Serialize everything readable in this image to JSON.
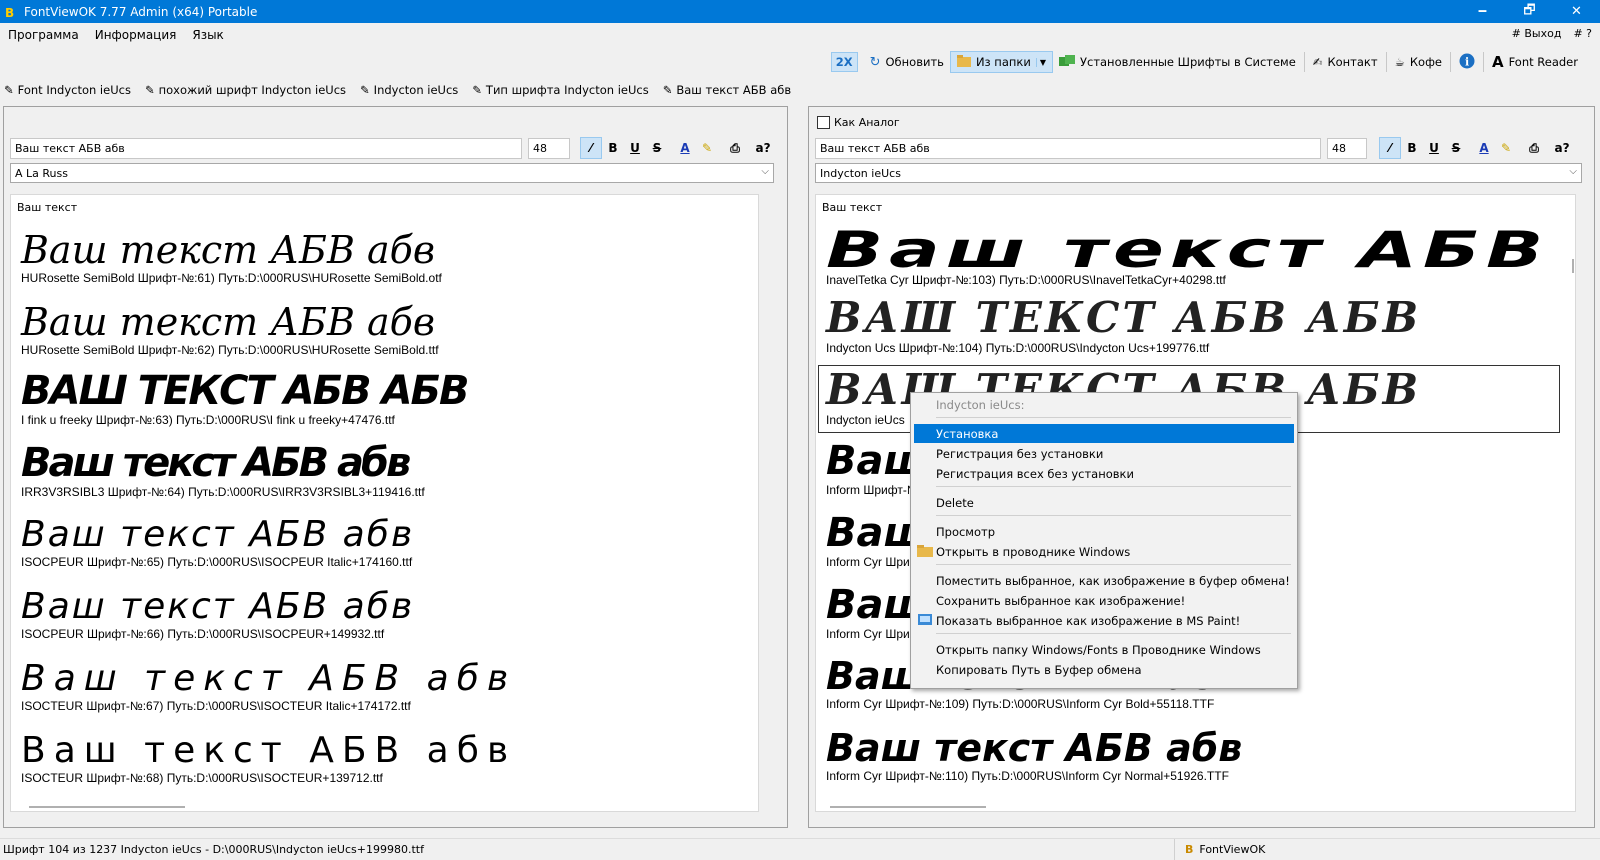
{
  "window": {
    "title": "FontViewOK 7.77 Admin (x64) Portable",
    "minimize": "🗕",
    "maximize": "🗗",
    "close": "✕"
  },
  "menubar": {
    "items": [
      "Программа",
      "Информация",
      "Язык"
    ],
    "exit": "# Выход",
    "help": "# ?"
  },
  "toolbar": {
    "zoom": "2X",
    "refresh": "Обновить",
    "from_folder": "Из папки",
    "installed": "Установленные Шрифты в Системе",
    "contact": "Контакт",
    "coffee": "Кофе",
    "font_reader": "Font Reader"
  },
  "tabs": [
    "Font Indycton ieUcs",
    "похожий шрифт  Indycton ieUcs",
    "Indycton ieUcs",
    "Тип шрифта  Indycton ieUcs",
    "Ваш текст АБВ абв"
  ],
  "left": {
    "text": "Ваш текст АБВ абв",
    "size": "48",
    "font": "A La Russ",
    "caption": "Ваш текст",
    "entries": [
      {
        "sample": "Ваш текст АБВ абв",
        "info": "HURosette SemiBold Шрифт-№:61) Путь:D:\\000RUS\\HURosette SemiBold.otf"
      },
      {
        "sample": "Ваш текст АБВ абв",
        "info": "HURosette SemiBold Шрифт-№:62) Путь:D:\\000RUS\\HURosette SemiBold.ttf"
      },
      {
        "sample": "ВАШ ТЕКСТ АБВ АБВ",
        "info": "I fink u freeky Шрифт-№:63) Путь:D:\\000RUS\\I fink u freeky+47476.ttf"
      },
      {
        "sample": "Ваш текст АБВ абв",
        "info": "IRR3V3RSIBL3 Шрифт-№:64) Путь:D:\\000RUS\\IRR3V3RSIBL3+119416.ttf"
      },
      {
        "sample": "Ваш текст АБВ абв",
        "info": "ISOCPEUR Шрифт-№:65) Путь:D:\\000RUS\\ISOCPEUR Italic+174160.ttf"
      },
      {
        "sample": "Ваш текст АБВ абв",
        "info": "ISOCPEUR Шрифт-№:66) Путь:D:\\000RUS\\ISOCPEUR+149932.ttf"
      },
      {
        "sample": "Ваш  текст  АБВ  абв",
        "info": "ISOCTEUR Шрифт-№:67) Путь:D:\\000RUS\\ISOCTEUR Italic+174172.ttf"
      },
      {
        "sample": "Ваш  текст  АБВ  абв",
        "info": "ISOCTEUR Шрифт-№:68) Путь:D:\\000RUS\\ISOCTEUR+139712.ttf"
      }
    ]
  },
  "right": {
    "analog_label": "Как Аналог",
    "text": "Ваш текст АБВ абв",
    "size": "48",
    "font": "Indycton ieUcs",
    "caption": "Ваш текст",
    "entries": [
      {
        "sample": "Ваш текст АБВ а",
        "info": "InavelTetka Cyr Шрифт-№:103) Путь:D:\\000RUS\\InavelTetkaCyr+40298.ttf"
      },
      {
        "sample": "ВАШ ТЕКСТ АБВ АБВ",
        "info": "Indycton Ucs Шрифт-№:104) Путь:D:\\000RUS\\Indycton Ucs+199776.ttf"
      },
      {
        "sample": "ВАШ ТЕКСТ АБВ АБВ",
        "info": "Indycton ieUcs"
      },
      {
        "sample": "Ваш",
        "info": "Inform Шрифт-№"
      },
      {
        "sample": "Ваш",
        "info": "Inform Cyr Шри"
      },
      {
        "sample": "Ваш",
        "info": "Inform Cyr Шри"
      },
      {
        "sample": "Ваш текст АБВ абв",
        "info": "Inform Cyr Шрифт-№:109) Путь:D:\\000RUS\\Inform Cyr Bold+55118.TTF"
      },
      {
        "sample": "Ваш текст АБВ абв",
        "info": "Inform Cyr Шрифт-№:110) Путь:D:\\000RUS\\Inform Cyr Normal+51926.TTF"
      }
    ]
  },
  "context_menu": {
    "header": "Indycton ieUcs:",
    "install": "Установка",
    "register": "Регистрация без установки",
    "register_all": "Регистрация всех без установки",
    "delete": "Delete",
    "preview": "Просмотр",
    "open_explorer": "Открыть в проводнике Windows",
    "copy_image": "Поместить выбранное, как изображение в буфер обмена!",
    "save_image": "Сохранить выбранное как изображение!",
    "show_paint": "Показать выбранное как изображение в MS Paint!",
    "open_fonts": "Открыть папку Windows/Fonts в Проводнике Windows",
    "copy_path": "Копировать Путь в Буфер обмена"
  },
  "status": {
    "left": "Шрифт 104 из 1237 Indycton ieUcs - D:\\000RUS\\Indycton ieUcs+199980.ttf",
    "right": "FontViewOK"
  }
}
